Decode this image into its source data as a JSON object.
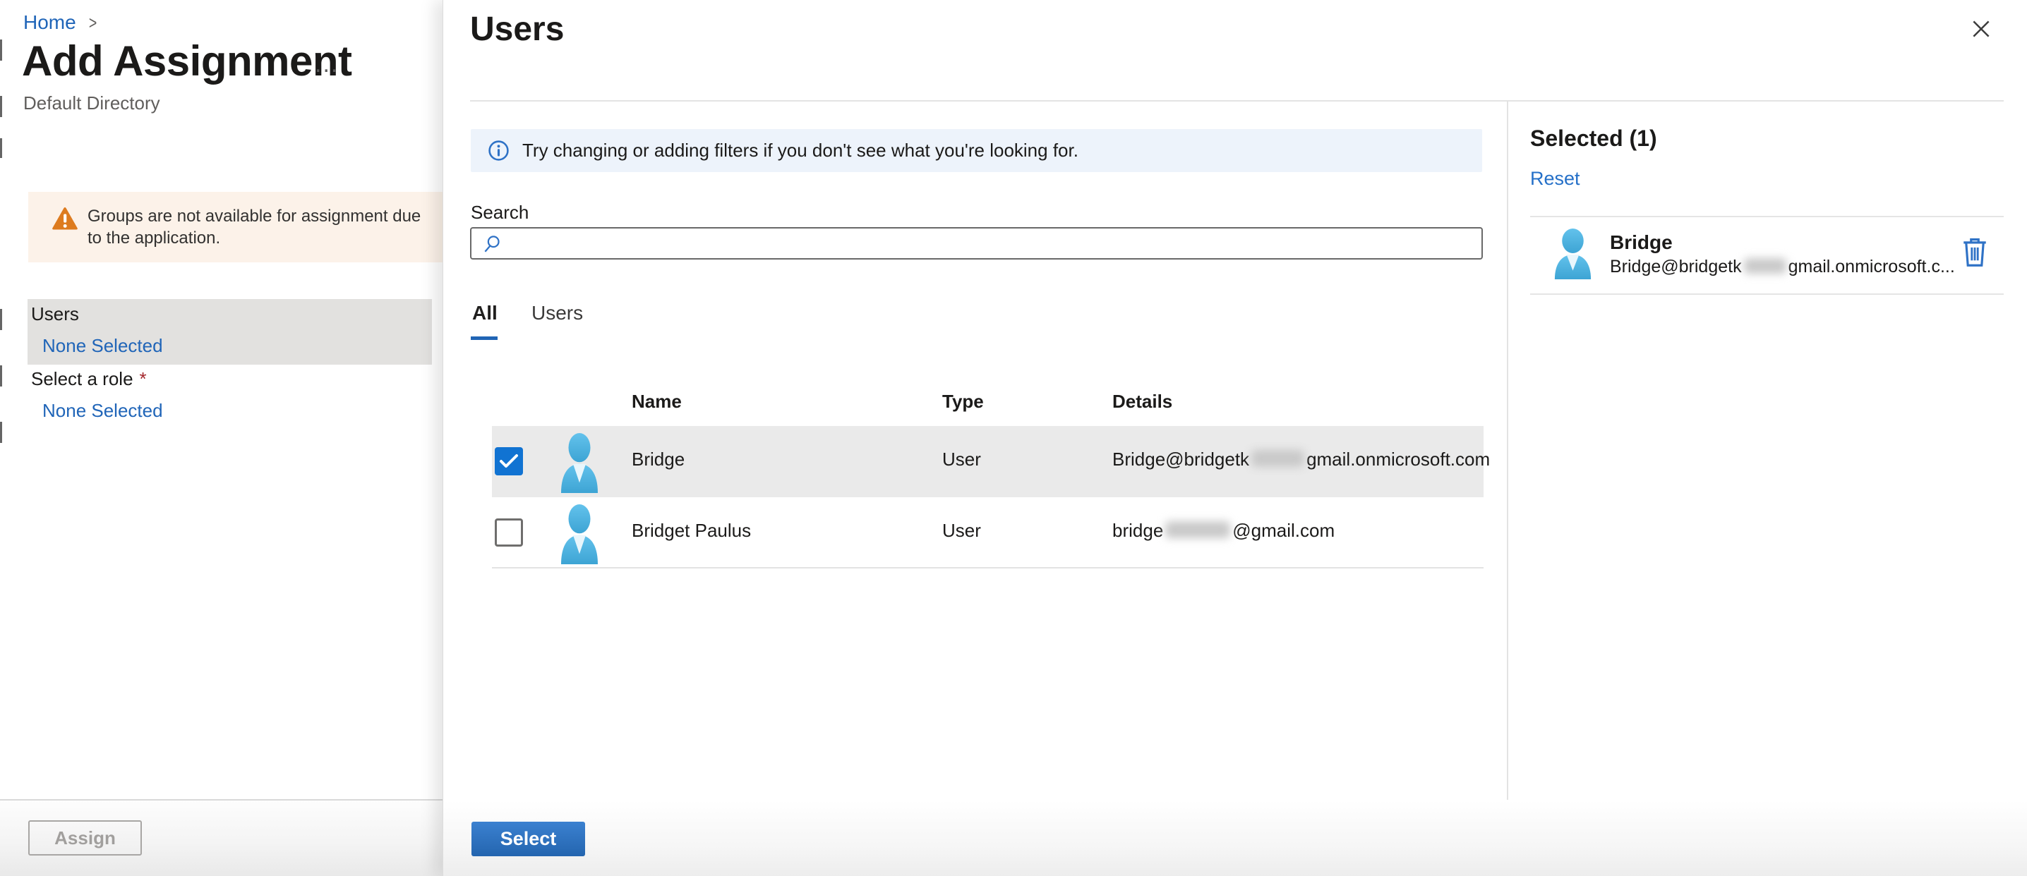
{
  "page": {
    "breadcrumb": {
      "home": "Home",
      "separator": ">"
    },
    "title": "Add Assignment",
    "title_ellipsis": "...",
    "subtitle": "Default Directory",
    "warning": {
      "text": "Groups are not available for assignment due to the application."
    },
    "fields": [
      {
        "label": "Users",
        "value": "None Selected",
        "required_mark": "",
        "selected": true
      },
      {
        "label": "Select a role",
        "value": "None Selected",
        "required_mark": "*",
        "selected": false
      }
    ],
    "assign_button": "Assign"
  },
  "panel": {
    "title": "Users",
    "info_banner": "Try changing or adding filters if you don't see what you're looking for.",
    "search": {
      "label": "Search",
      "value": "",
      "placeholder": ""
    },
    "tabs": [
      {
        "label": "All",
        "active": true
      },
      {
        "label": "Users",
        "active": false
      }
    ],
    "table": {
      "columns": [
        "Name",
        "Type",
        "Details"
      ],
      "rows": [
        {
          "checked": true,
          "name": "Bridge",
          "type": "User",
          "details_prefix": "Bridge@bridgetk",
          "details_redacted": true,
          "details_suffix": "gmail.onmicrosoft.com"
        },
        {
          "checked": false,
          "name": "Bridget Paulus",
          "type": "User",
          "details_prefix": "bridge",
          "details_redacted": true,
          "details_suffix": "@gmail.com"
        }
      ]
    },
    "select_button": "Select"
  },
  "selected_rail": {
    "title": "Selected (1)",
    "reset_label": "Reset",
    "items": [
      {
        "name": "Bridge",
        "email_prefix": "Bridge@bridgetk",
        "email_redacted": true,
        "email_suffix": "gmail.onmicrosoft.c..."
      }
    ]
  },
  "icons": {
    "close": "close-icon x-glyph",
    "warning": "warning-triangle-icon",
    "info": "info-circle-icon",
    "search": "magnifier-icon",
    "person": "person-avatar-icon",
    "trash": "trash-icon",
    "checkmark": "check-icon",
    "more": "ellipsis-icon",
    "chevron": "breadcrumb-chevron-icon"
  },
  "colors": {
    "link_blue": "#2065b8",
    "tab_underline": "#2065b5",
    "checkbox_blue": "#1173d2",
    "select_button_blue": "#2e74c4",
    "icon_blue": "#2f72c6",
    "warning_orange": "#dd7b1f",
    "warning_bg": "#fcf2e9",
    "info_banner_bg": "#edf3fb",
    "selected_row_gray": "#eaeaea",
    "selected_field_gray": "#e2e1df",
    "avatar_blue": "#4fb4e2"
  }
}
